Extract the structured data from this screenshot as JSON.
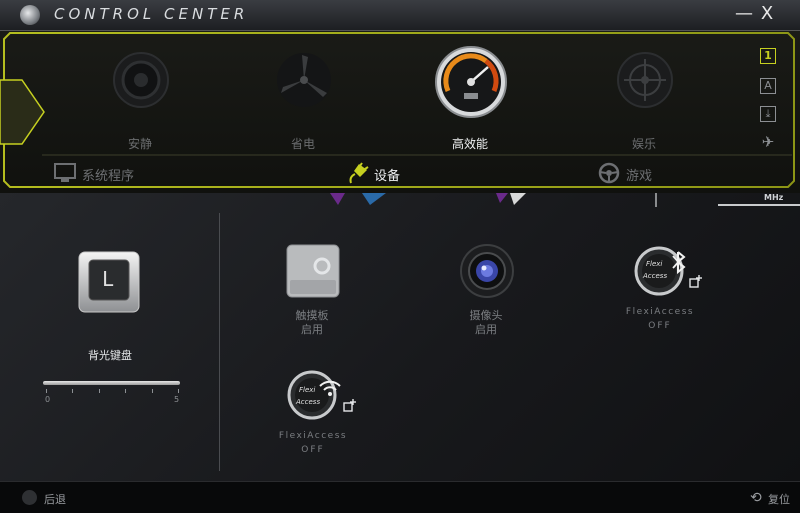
{
  "window": {
    "title": "CONTROL CENTER",
    "minimize": "—",
    "close": "X"
  },
  "modes": [
    {
      "label": "安静",
      "icon": "speaker-icon",
      "active": false
    },
    {
      "label": "省电",
      "icon": "fan-icon",
      "active": false
    },
    {
      "label": "高效能",
      "icon": "speedometer-icon",
      "active": true
    },
    {
      "label": "娱乐",
      "icon": "target-icon",
      "active": false
    }
  ],
  "profile_icons": {
    "one": "1",
    "auto": "A",
    "download": "⤓",
    "airplane": "✈"
  },
  "nav": {
    "system": "系统程序",
    "devices": "设备",
    "games": "游戏"
  },
  "keyboard": {
    "label": "背光键盘",
    "key_letter": "L",
    "slider_min": "0",
    "slider_max": "5",
    "brightness_fraction": 1.0
  },
  "devices": {
    "touchpad": {
      "name": "触摸板",
      "state": "启用"
    },
    "camera": {
      "name": "摄像头",
      "state": "启用"
    },
    "flexi_bt": {
      "name": "FlexiAccess",
      "state": "OFF",
      "logo_line1": "Flexi",
      "logo_line2": "Access"
    },
    "flexi_wifi": {
      "name": "FlexiAccess",
      "state": "OFF",
      "logo_line1": "Flexi",
      "logo_line2": "Access"
    }
  },
  "cpu_freq_unit": "MHz",
  "bottom": {
    "back": "后退",
    "reset": "复位"
  },
  "colors": {
    "accent": "#c6d020",
    "active_text": "#f2f4f5",
    "inactive_text": "#6a6c6e"
  }
}
